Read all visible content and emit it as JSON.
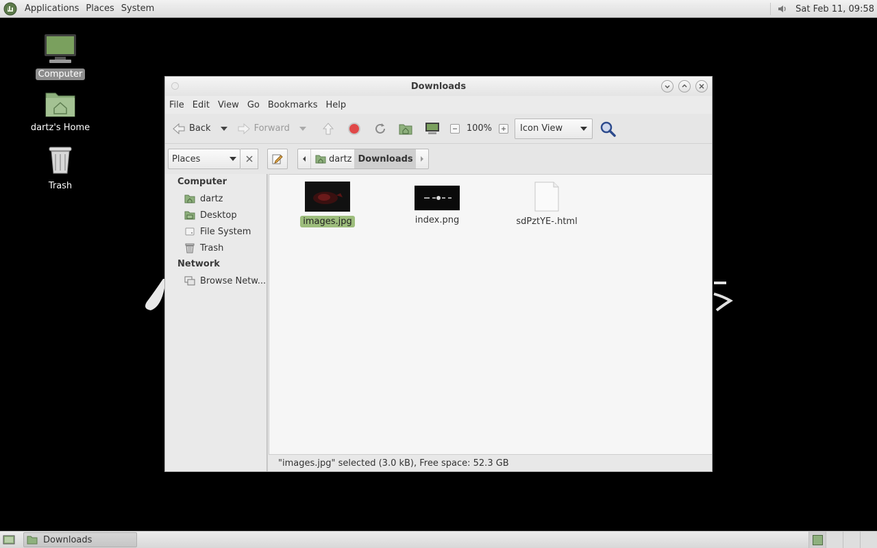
{
  "top_panel": {
    "menus": [
      "Applications",
      "Places",
      "System"
    ],
    "clock": "Sat Feb 11, 09:58"
  },
  "desktop": {
    "icons": [
      {
        "label": "Computer",
        "selected": true
      },
      {
        "label": "dartz's Home",
        "selected": false
      },
      {
        "label": "Trash",
        "selected": false
      }
    ]
  },
  "window": {
    "title": "Downloads",
    "menubar": [
      "File",
      "Edit",
      "View",
      "Go",
      "Bookmarks",
      "Help"
    ],
    "toolbar": {
      "back_label": "Back",
      "forward_label": "Forward",
      "zoom_level": "100%",
      "view_mode": "Icon View"
    },
    "location": {
      "sidebar_mode": "Places",
      "path": [
        "dartz",
        "Downloads"
      ]
    },
    "sidebar": {
      "computer_heading": "Computer",
      "computer_items": [
        "dartz",
        "Desktop",
        "File System",
        "Trash"
      ],
      "network_heading": "Network",
      "network_items": [
        "Browse Netw..."
      ]
    },
    "files": [
      {
        "name": "images.jpg",
        "type": "image",
        "selected": true
      },
      {
        "name": "index.png",
        "type": "image",
        "selected": false
      },
      {
        "name": "sdPztYE-.html",
        "type": "html",
        "selected": false
      }
    ],
    "status": "\"images.jpg\" selected (3.0 kB), Free space: 52.3 GB"
  },
  "bottom_panel": {
    "task_label": "Downloads"
  },
  "colors": {
    "selection_green": "#9dbd7c",
    "folder_green": "#8eb07d"
  }
}
